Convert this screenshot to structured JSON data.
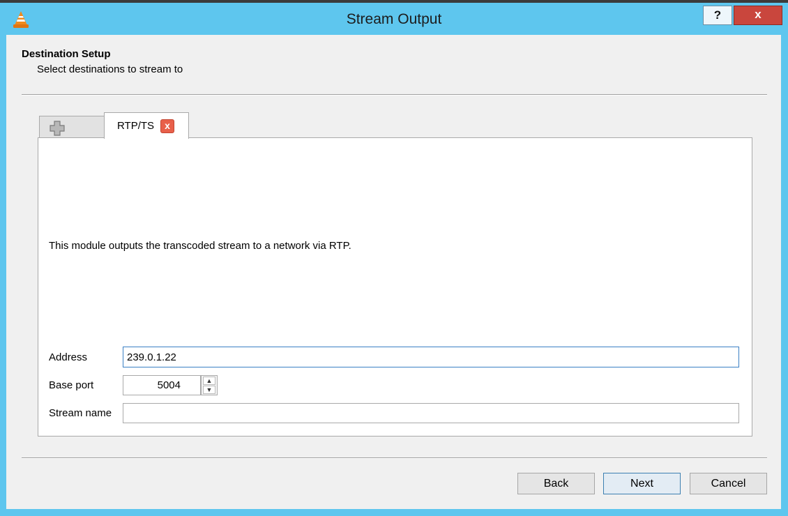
{
  "window": {
    "title": "Stream Output",
    "help_label": "?",
    "close_label": "x",
    "app_icon": "vlc-cone-icon"
  },
  "header": {
    "title": "Destination Setup",
    "subtitle": "Select destinations to stream to"
  },
  "tabs": {
    "add_icon": "plus-icon",
    "active_label": "RTP/TS",
    "close_icon": "close-tab-icon",
    "close_glyph": "x"
  },
  "panel": {
    "description": "This module outputs the transcoded stream to a network via RTP.",
    "fields": {
      "address_label": "Address",
      "address_value": "239.0.1.22",
      "base_port_label": "Base port",
      "base_port_value": "5004",
      "stream_name_label": "Stream name",
      "stream_name_value": ""
    }
  },
  "buttons": {
    "back": "Back",
    "next": "Next",
    "cancel": "Cancel"
  },
  "colors": {
    "title_bar": "#5ec6ee",
    "close_button": "#c9463d",
    "tab_close": "#e8604a"
  }
}
